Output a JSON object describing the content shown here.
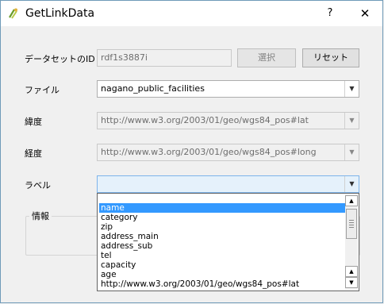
{
  "window": {
    "title": "GetLinkData",
    "help_label": "?",
    "close_label": "✕"
  },
  "dataset": {
    "label": "データセットのID",
    "value": "rdf1s3887i",
    "select_button": "選択",
    "reset_button": "リセット"
  },
  "file": {
    "label": "ファイル",
    "value": "nagano_public_facilities"
  },
  "latitude": {
    "label": "緯度",
    "value": "http://www.w3.org/2003/01/geo/wgs84_pos#lat"
  },
  "longitude": {
    "label": "経度",
    "value": "http://www.w3.org/2003/01/geo/wgs84_pos#long"
  },
  "label_field": {
    "label": "ラベル",
    "value": ""
  },
  "info_group": {
    "title": "情報"
  },
  "dropdown": {
    "items": [
      "name",
      "category",
      "zip",
      "address_main",
      "address_sub",
      "tel",
      "capacity",
      "age",
      "http://www.w3.org/2003/01/geo/wgs84_pos#lat"
    ],
    "selected_index": 0
  },
  "icons": {
    "app": "qgis-plugin-icon",
    "combo_arrow": "chevron-down-icon",
    "scroll_up": "arrow-up-icon",
    "scroll_down": "arrow-down-icon"
  }
}
